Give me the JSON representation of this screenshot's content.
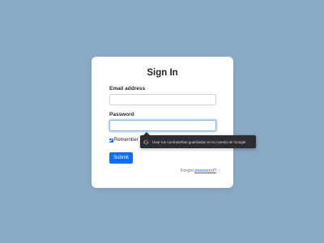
{
  "form": {
    "title": "Sign In",
    "email_label": "Email address",
    "email_value": "",
    "password_label": "Password",
    "password_value": "",
    "remember_label": "Remember",
    "remember_checked": true,
    "submit_label": "Submit",
    "forgot_prefix": "Forgot ",
    "forgot_link": "password?"
  },
  "tooltip": {
    "icon": "google-icon",
    "text": "Usar tus contraseñas guardadas en tu cuenta de Google"
  },
  "colors": {
    "background": "#8aa9c6",
    "primary": "#0d6efd",
    "tooltip_bg": "#2b2d30"
  }
}
